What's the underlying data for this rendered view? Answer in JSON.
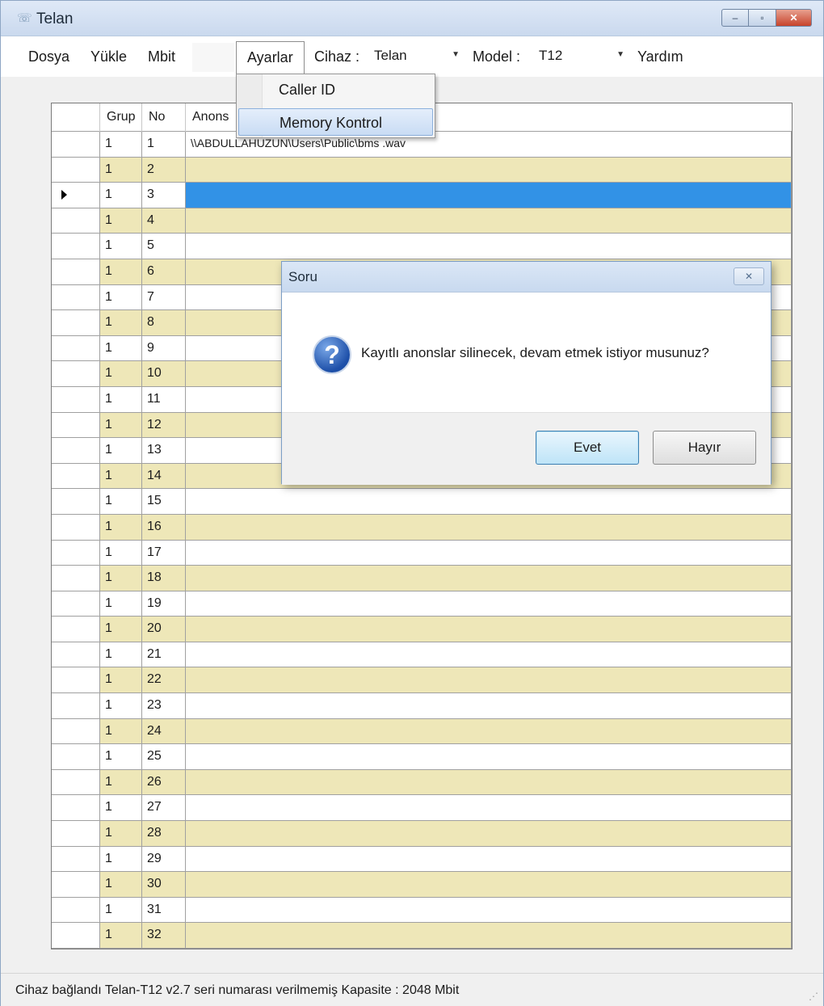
{
  "window": {
    "title": "Telan",
    "icon": "telan-app-icon",
    "controls": {
      "minimize": "–",
      "maximize": "▫",
      "close": "✕"
    }
  },
  "menu": {
    "dosya": "Dosya",
    "yukle": "Yükle",
    "mbit": "Mbit",
    "ayarlar": "Ayarlar",
    "cihaz_label": "Cihaz :",
    "cihaz_value": "Telan",
    "model_label": "Model :",
    "model_value": "T12",
    "yardim": "Yardım"
  },
  "dropdown": {
    "items": [
      {
        "label": "Caller ID",
        "highlighted": false
      },
      {
        "label": "Memory Kontrol",
        "highlighted": true
      }
    ]
  },
  "grid": {
    "headers": {
      "grup": "Grup",
      "no": "No",
      "anons": "Anons"
    },
    "selected_row_no": "3",
    "rows": [
      {
        "grup": "1",
        "no": "1",
        "anons": "\\\\ABDULLAHUZUN\\Users\\Public\\bms .wav"
      },
      {
        "grup": "1",
        "no": "2",
        "anons": ""
      },
      {
        "grup": "1",
        "no": "3",
        "anons": ""
      },
      {
        "grup": "1",
        "no": "4",
        "anons": ""
      },
      {
        "grup": "1",
        "no": "5",
        "anons": ""
      },
      {
        "grup": "1",
        "no": "6",
        "anons": ""
      },
      {
        "grup": "1",
        "no": "7",
        "anons": ""
      },
      {
        "grup": "1",
        "no": "8",
        "anons": ""
      },
      {
        "grup": "1",
        "no": "9",
        "anons": ""
      },
      {
        "grup": "1",
        "no": "10",
        "anons": ""
      },
      {
        "grup": "1",
        "no": "11",
        "anons": ""
      },
      {
        "grup": "1",
        "no": "12",
        "anons": ""
      },
      {
        "grup": "1",
        "no": "13",
        "anons": ""
      },
      {
        "grup": "1",
        "no": "14",
        "anons": ""
      },
      {
        "grup": "1",
        "no": "15",
        "anons": ""
      },
      {
        "grup": "1",
        "no": "16",
        "anons": ""
      },
      {
        "grup": "1",
        "no": "17",
        "anons": ""
      },
      {
        "grup": "1",
        "no": "18",
        "anons": ""
      },
      {
        "grup": "1",
        "no": "19",
        "anons": ""
      },
      {
        "grup": "1",
        "no": "20",
        "anons": ""
      },
      {
        "grup": "1",
        "no": "21",
        "anons": ""
      },
      {
        "grup": "1",
        "no": "22",
        "anons": ""
      },
      {
        "grup": "1",
        "no": "23",
        "anons": ""
      },
      {
        "grup": "1",
        "no": "24",
        "anons": ""
      },
      {
        "grup": "1",
        "no": "25",
        "anons": ""
      },
      {
        "grup": "1",
        "no": "26",
        "anons": ""
      },
      {
        "grup": "1",
        "no": "27",
        "anons": ""
      },
      {
        "grup": "1",
        "no": "28",
        "anons": ""
      },
      {
        "grup": "1",
        "no": "29",
        "anons": ""
      },
      {
        "grup": "1",
        "no": "30",
        "anons": ""
      },
      {
        "grup": "1",
        "no": "31",
        "anons": ""
      },
      {
        "grup": "1",
        "no": "32",
        "anons": ""
      }
    ]
  },
  "dialog": {
    "title": "Soru",
    "close": "✕",
    "icon": "question-icon",
    "icon_glyph": "?",
    "message": "Kayıtlı anonslar silinecek, devam etmek istiyor musunuz?",
    "yes_label": "Evet",
    "no_label": "Hayır"
  },
  "status": {
    "text": "Cihaz bağlandı Telan-T12 v2.7 seri numarası verilmemiş Kapasite : 2048 Mbit",
    "grip": "⋰"
  },
  "colors": {
    "row_alt": "#eee7b8",
    "row_selected": "#3292e6",
    "titlebar": "#cad9ee"
  }
}
